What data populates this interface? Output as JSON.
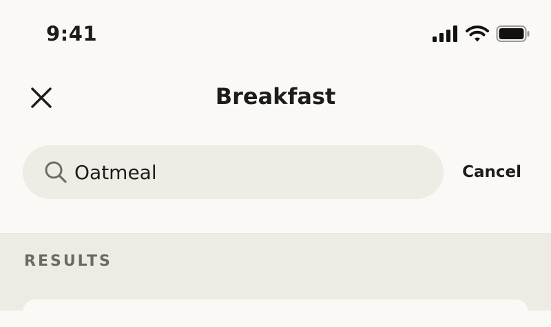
{
  "status_bar": {
    "time": "9:41",
    "icons": [
      "cellular-signal-icon",
      "wifi-icon",
      "battery-icon"
    ]
  },
  "nav": {
    "title": "Breakfast",
    "close_icon": "close-icon"
  },
  "search": {
    "value": "Oatmeal",
    "icon": "search-icon",
    "cancel_label": "Cancel"
  },
  "results": {
    "header": "RESULTS"
  },
  "colors": {
    "background": "#fbf9f6",
    "search_field": "#efebe5",
    "results_background": "#eeeae4",
    "text": "#1c1c1c",
    "muted_text": "#6c6862"
  }
}
